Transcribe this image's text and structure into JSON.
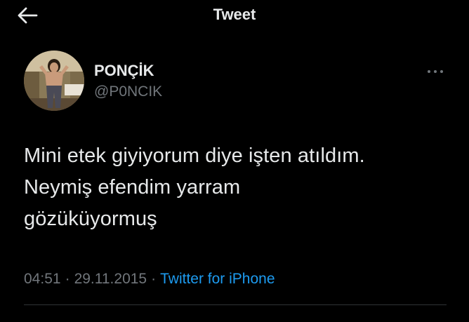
{
  "header": {
    "title": "Tweet",
    "back_icon": "arrow-left-icon"
  },
  "tweet": {
    "author": {
      "display_name": "PONÇİK",
      "handle": "@P0NCIK",
      "avatar": "profile-photo"
    },
    "more_icon": "more-horizontal-icon",
    "text": "Mini etek giyiyorum diye işten atıldım.\nNeymiş efendim yarram\ngözüküyormuş",
    "time": "04:51",
    "date": "29.11.2015",
    "separator": "·",
    "source": "Twitter for iPhone"
  },
  "colors": {
    "background": "#000000",
    "primary_text": "#e7e9ea",
    "secondary_text": "#71767b",
    "accent": "#1d9bf0",
    "divider": "#2f3336"
  }
}
